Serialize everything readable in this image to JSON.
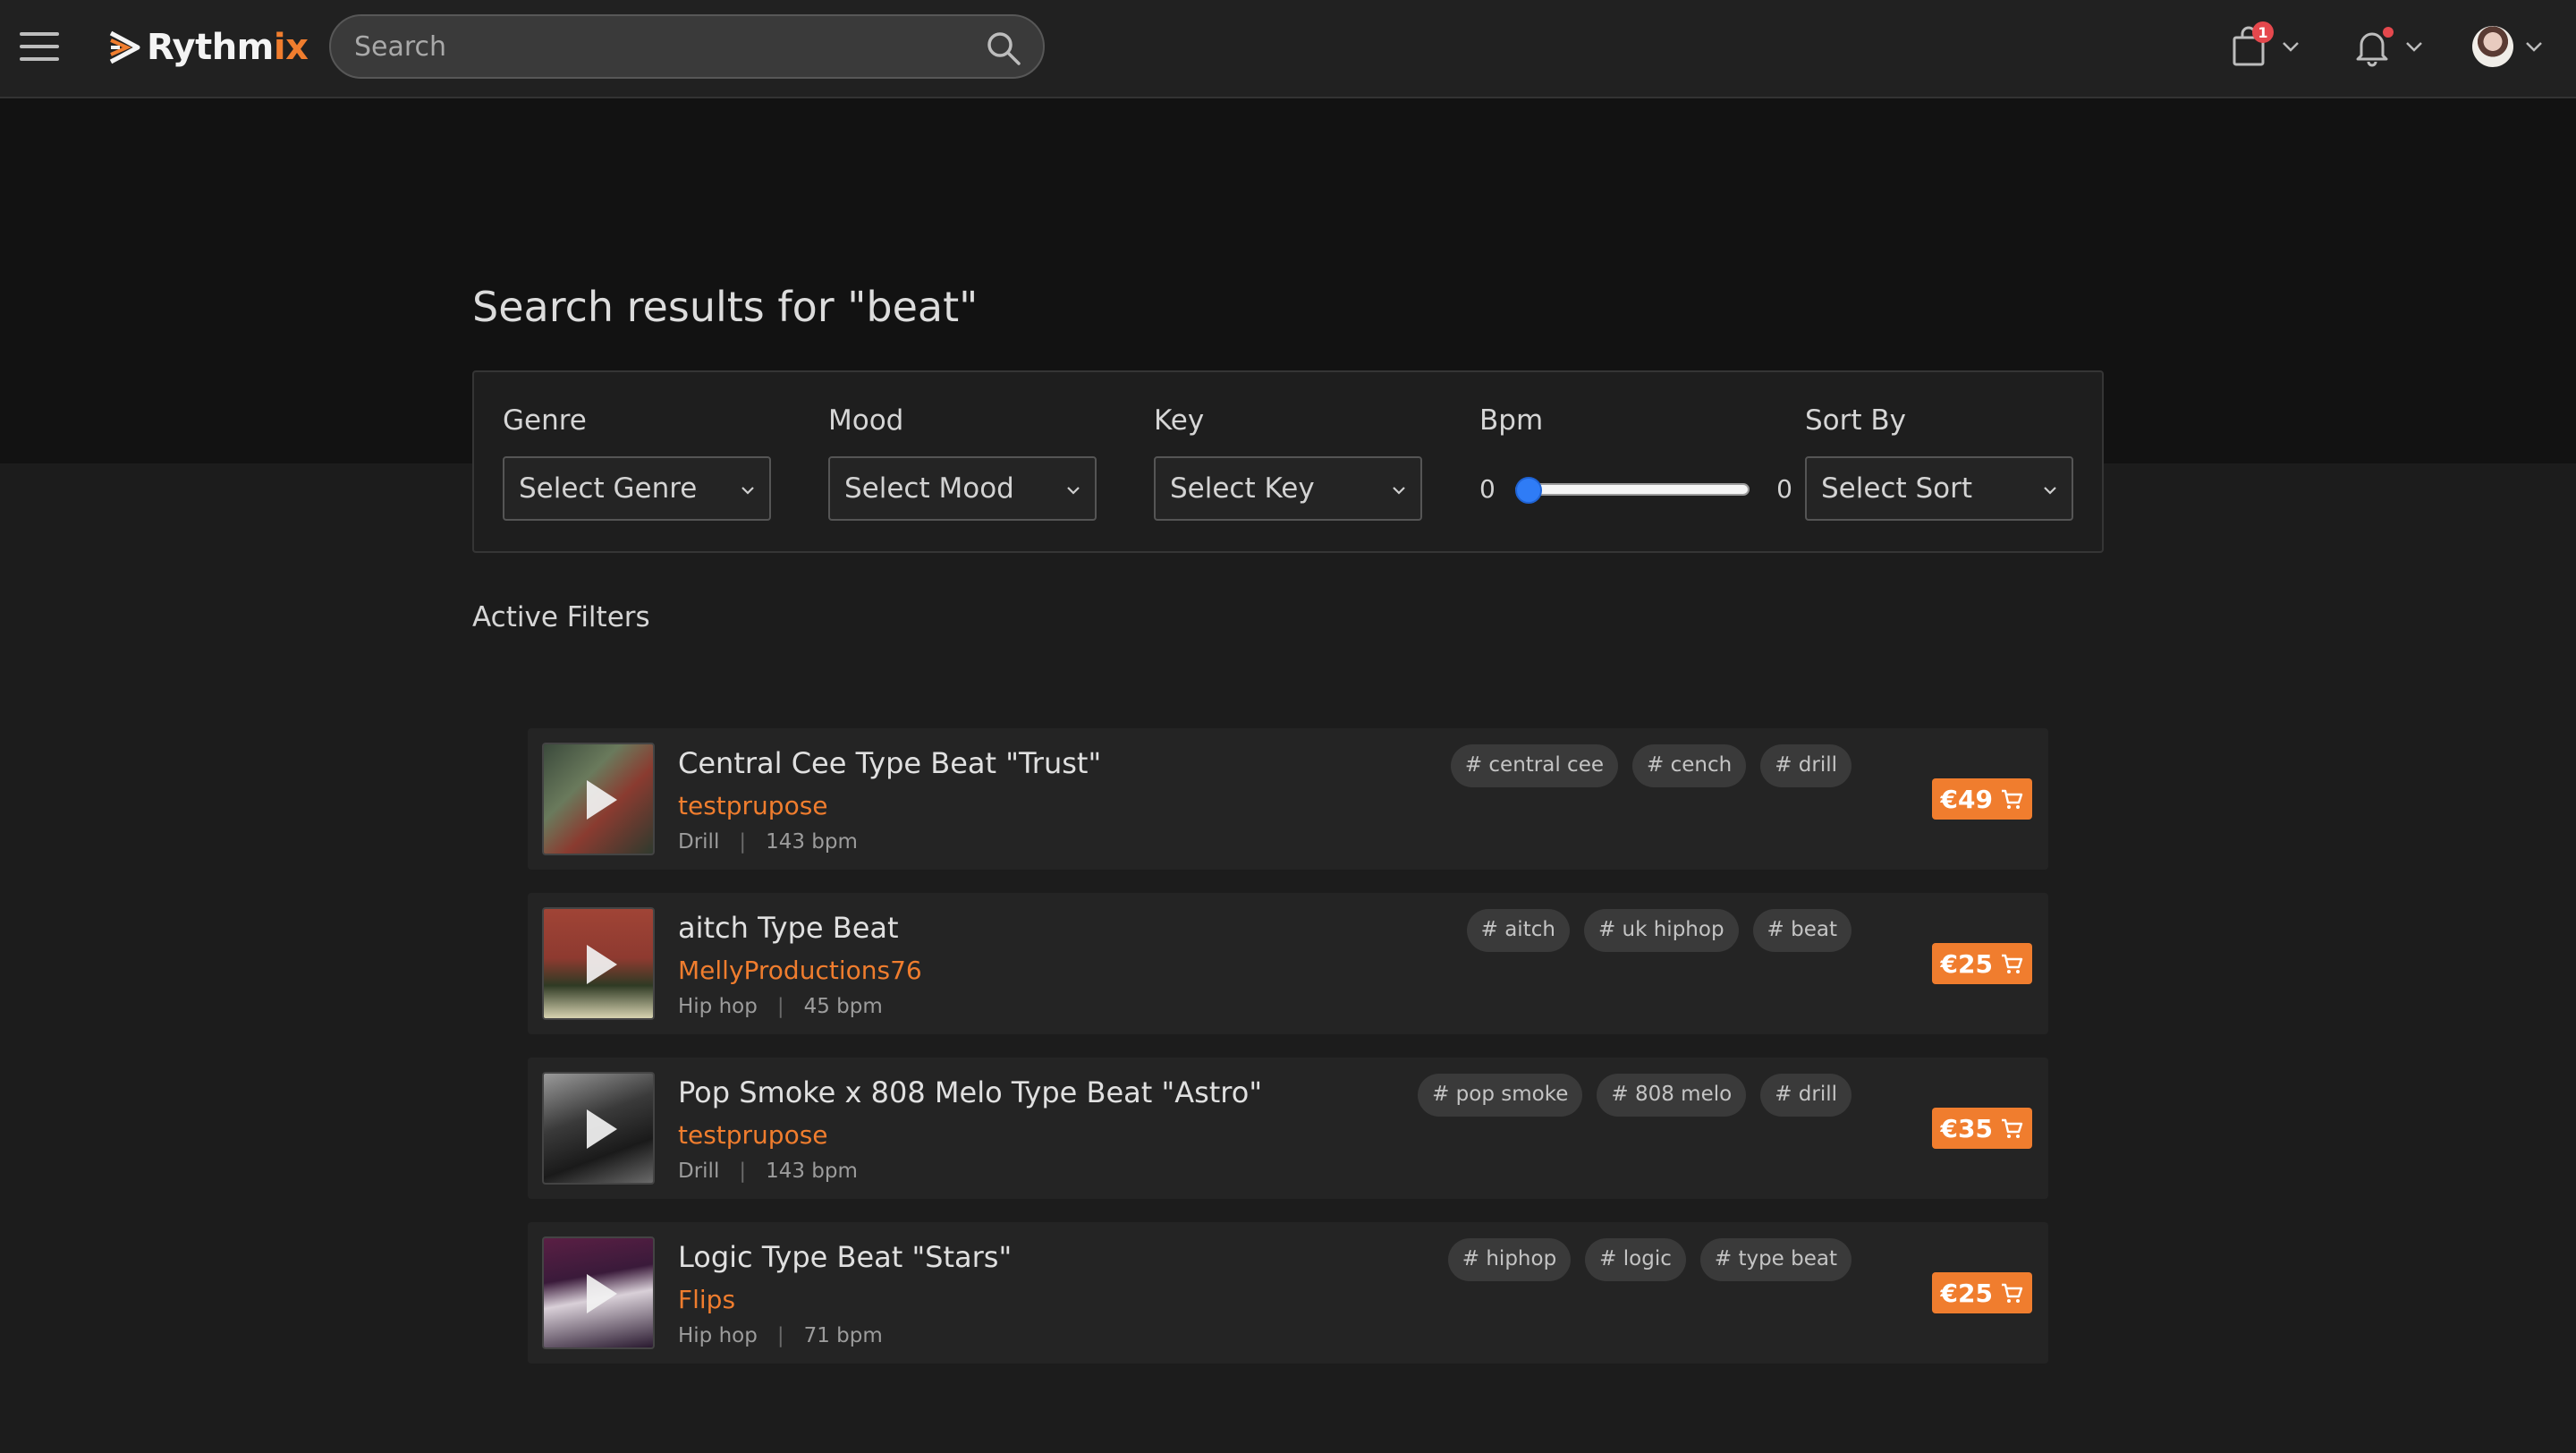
{
  "app": {
    "logo_text_primary": "Rythm",
    "logo_text_accent": "ix",
    "accent_color": "#f07d2e"
  },
  "header": {
    "search_placeholder": "Search",
    "cart_badge": "1",
    "icons": {
      "menu": "hamburger-icon",
      "search": "search-icon",
      "cart": "shopping-bag-icon",
      "notifications": "bell-icon",
      "avatar": "user-avatar"
    }
  },
  "page": {
    "title": "Search results for \"beat\"",
    "active_filters_label": "Active Filters"
  },
  "filters": {
    "genre": {
      "label": "Genre",
      "value": "Select Genre"
    },
    "mood": {
      "label": "Mood",
      "value": "Select Mood"
    },
    "key": {
      "label": "Key",
      "value": "Select Key"
    },
    "bpm": {
      "label": "Bpm",
      "min": "0",
      "max": "0",
      "level": 0
    },
    "sort": {
      "label": "Sort By",
      "value": "Select Sort"
    }
  },
  "results": [
    {
      "title": "Central Cee Type Beat \"Trust\"",
      "producer": "testprupose",
      "genre": "Drill",
      "bpm": "143 bpm",
      "tags": [
        "# central cee",
        "# cench",
        "# drill"
      ],
      "price": "€49"
    },
    {
      "title": "aitch Type Beat",
      "producer": "MellyProductions76",
      "genre": "Hip hop",
      "bpm": "45 bpm",
      "tags": [
        "# aitch",
        "# uk hiphop",
        "# beat"
      ],
      "price": "€25"
    },
    {
      "title": "Pop Smoke x 808 Melo Type Beat \"Astro\"",
      "producer": "testprupose",
      "genre": "Drill",
      "bpm": "143 bpm",
      "tags": [
        "# pop smoke",
        "# 808 melo",
        "# drill"
      ],
      "price": "€35"
    },
    {
      "title": "Logic Type Beat \"Stars\"",
      "producer": "Flips",
      "genre": "Hip hop",
      "bpm": "71 bpm",
      "tags": [
        "# hiphop",
        "# logic",
        "# type beat"
      ],
      "price": "€25"
    }
  ]
}
